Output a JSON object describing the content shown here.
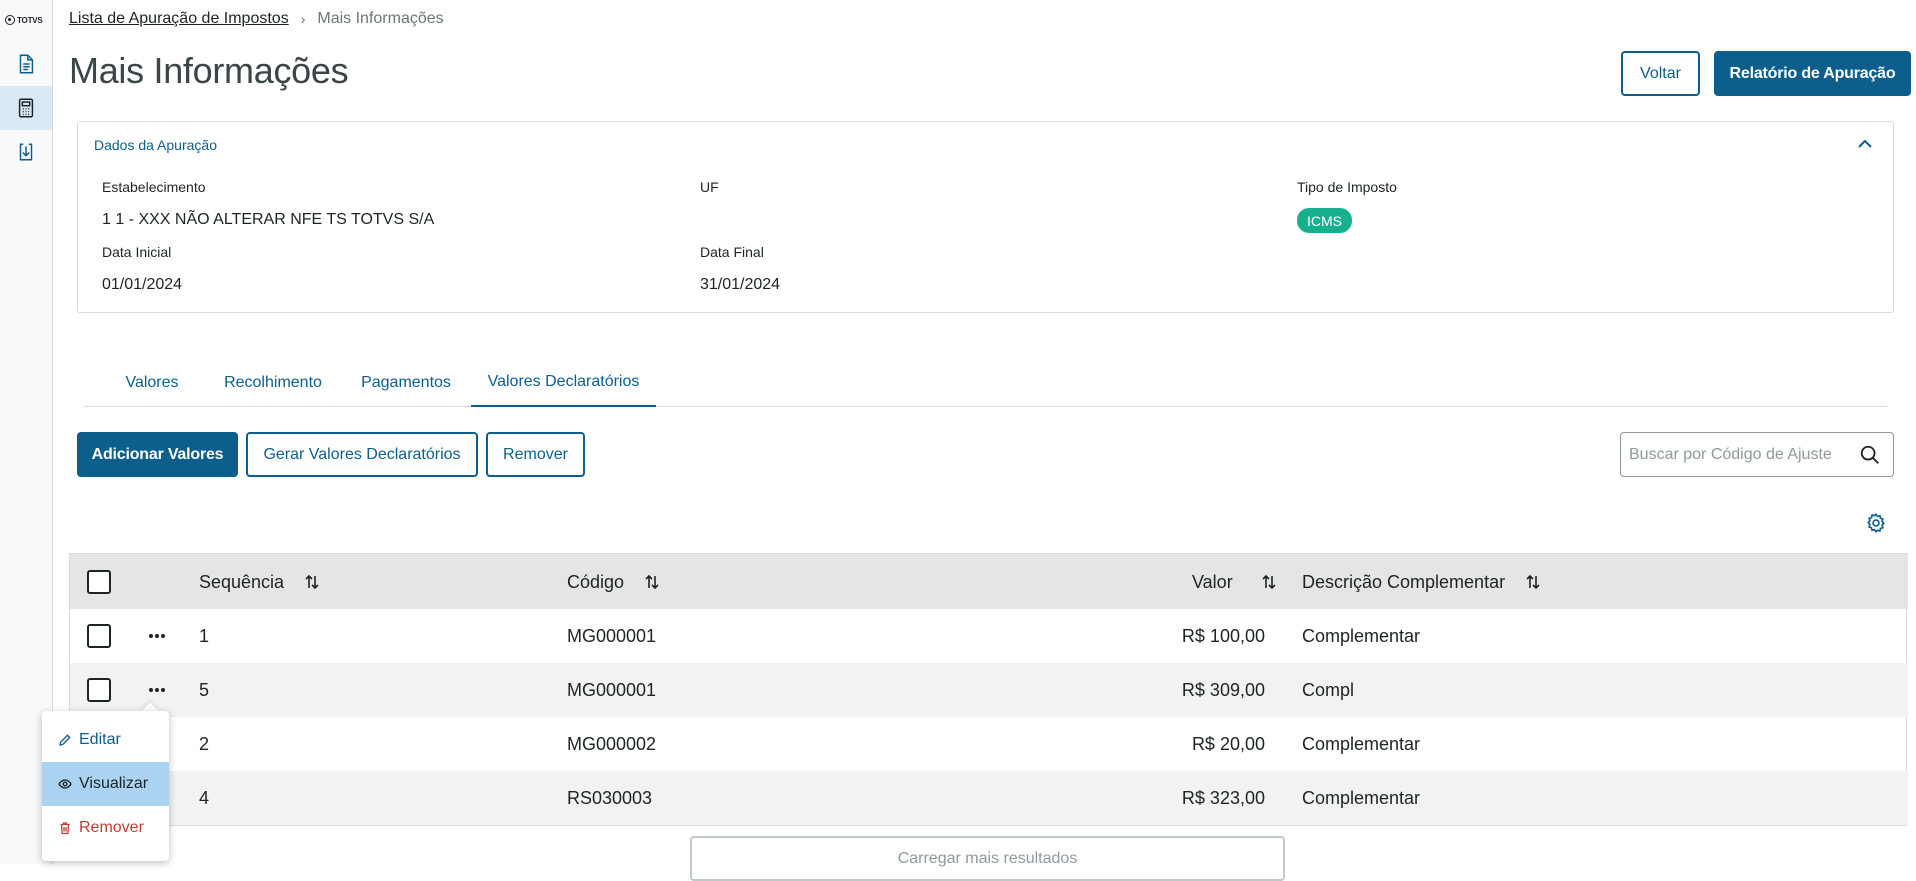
{
  "sidebar": {
    "logo": "TOTVS",
    "items": [
      {
        "icon": "document-icon",
        "active": false
      },
      {
        "icon": "calculator-icon",
        "active": true
      },
      {
        "icon": "download-file-icon",
        "active": false
      }
    ]
  },
  "breadcrumb": {
    "parent": "Lista de Apuração de Impostos",
    "current": "Mais Informações"
  },
  "page": {
    "title": "Mais Informações",
    "back_label": "Voltar",
    "report_label": "Relatório de Apuração"
  },
  "details": {
    "title": "Dados da Apuração",
    "estabelecimento_label": "Estabelecimento",
    "estabelecimento_value": "1 1 - XXX NÃO ALTERAR NFE TS TOTVS S/A",
    "uf_label": "UF",
    "uf_value": "",
    "tipo_label": "Tipo de Imposto",
    "tipo_value": "ICMS",
    "data_inicial_label": "Data Inicial",
    "data_inicial_value": "01/01/2024",
    "data_final_label": "Data Final",
    "data_final_value": "31/01/2024"
  },
  "tabs": [
    "Valores",
    "Recolhimento",
    "Pagamentos",
    "Valores Declaratórios"
  ],
  "active_tab": "Valores Declaratórios",
  "actions": {
    "add": "Adicionar Valores",
    "generate": "Gerar Valores Declaratórios",
    "remove": "Remover"
  },
  "search": {
    "placeholder": "Buscar por Código de Ajuste",
    "value": ""
  },
  "table": {
    "columns": [
      "Sequência",
      "Código",
      "Valor",
      "Descrição Complementar"
    ],
    "rows": [
      {
        "seq": "1",
        "codigo": "MG000001",
        "valor": "R$ 100,00",
        "descricao": "Complementar"
      },
      {
        "seq": "5",
        "codigo": "MG000001",
        "valor": "R$ 309,00",
        "descricao": "Compl"
      },
      {
        "seq": "2",
        "codigo": "MG000002",
        "valor": "R$ 20,00",
        "descricao": "Complementar"
      },
      {
        "seq": "4",
        "codigo": "RS030003",
        "valor": "R$ 323,00",
        "descricao": "Complementar"
      }
    ],
    "load_more": "Carregar mais resultados"
  },
  "row_menu": {
    "items": [
      {
        "label": "Editar",
        "icon": "pencil-icon"
      },
      {
        "label": "Visualizar",
        "icon": "eye-icon"
      },
      {
        "label": "Remover",
        "icon": "trash-icon"
      }
    ]
  },
  "colors": {
    "primary": "#0c5f8d",
    "tag": "#17b08f",
    "danger": "#be3e37",
    "highlight": "#a9d3f0"
  }
}
